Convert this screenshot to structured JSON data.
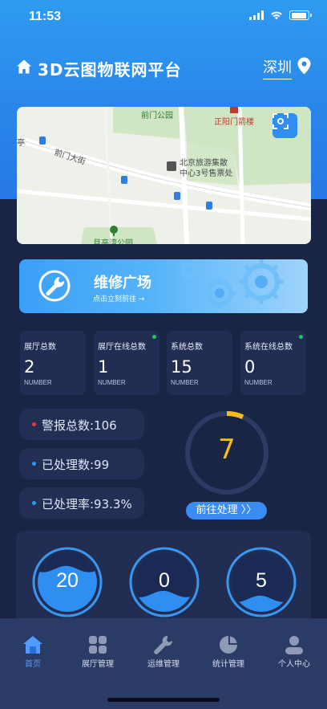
{
  "status_bar": {
    "time": "11:53"
  },
  "header": {
    "title": "3D云图物联网平台",
    "city": "深圳"
  },
  "map": {
    "labels": [
      "前门公园",
      "正阳门箭楼",
      "前门大街",
      "北京旅游集散",
      "中心3号售票处",
      "月亮湾公园",
      "亭"
    ]
  },
  "repair_banner": {
    "title": "维修广场",
    "subtitle": "点击立刻前往 →"
  },
  "stats": [
    {
      "label": "展厅总数",
      "value": "2",
      "unit": "NUMBER"
    },
    {
      "label": "展厅在线总数",
      "value": "1",
      "unit": "NUMBER"
    },
    {
      "label": "系统总数",
      "value": "15",
      "unit": "NUMBER"
    },
    {
      "label": "系统在线总数",
      "value": "0",
      "unit": "NUMBER"
    }
  ],
  "alarms": [
    {
      "text": "警报总数:106",
      "dot_color": "#e5394b"
    },
    {
      "text": "已处理数:99",
      "dot_color": "#2f9bf0"
    },
    {
      "text": "已处理率:93.3%",
      "dot_color": "#2f9bf0"
    }
  ],
  "pending": {
    "value": "7",
    "button": "前往处理 〉〉",
    "ring_progress": 0.067
  },
  "gauges": [
    {
      "value": "20",
      "fill_level": 0.72
    },
    {
      "value": "0",
      "fill_level": 0.3
    },
    {
      "value": "5",
      "fill_level": 0.22
    }
  ],
  "tabbar": {
    "items": [
      {
        "label": "首页",
        "active": true
      },
      {
        "label": "展厅管理",
        "active": false
      },
      {
        "label": "运维管理",
        "active": false
      },
      {
        "label": "统计管理",
        "active": false
      },
      {
        "label": "个人中心",
        "active": false
      }
    ]
  },
  "colors": {
    "accent": "#3a8bf3",
    "panel": "#212d52",
    "background": "#1a2444",
    "warning": "#f6bb1d",
    "online": "#25c25d"
  }
}
